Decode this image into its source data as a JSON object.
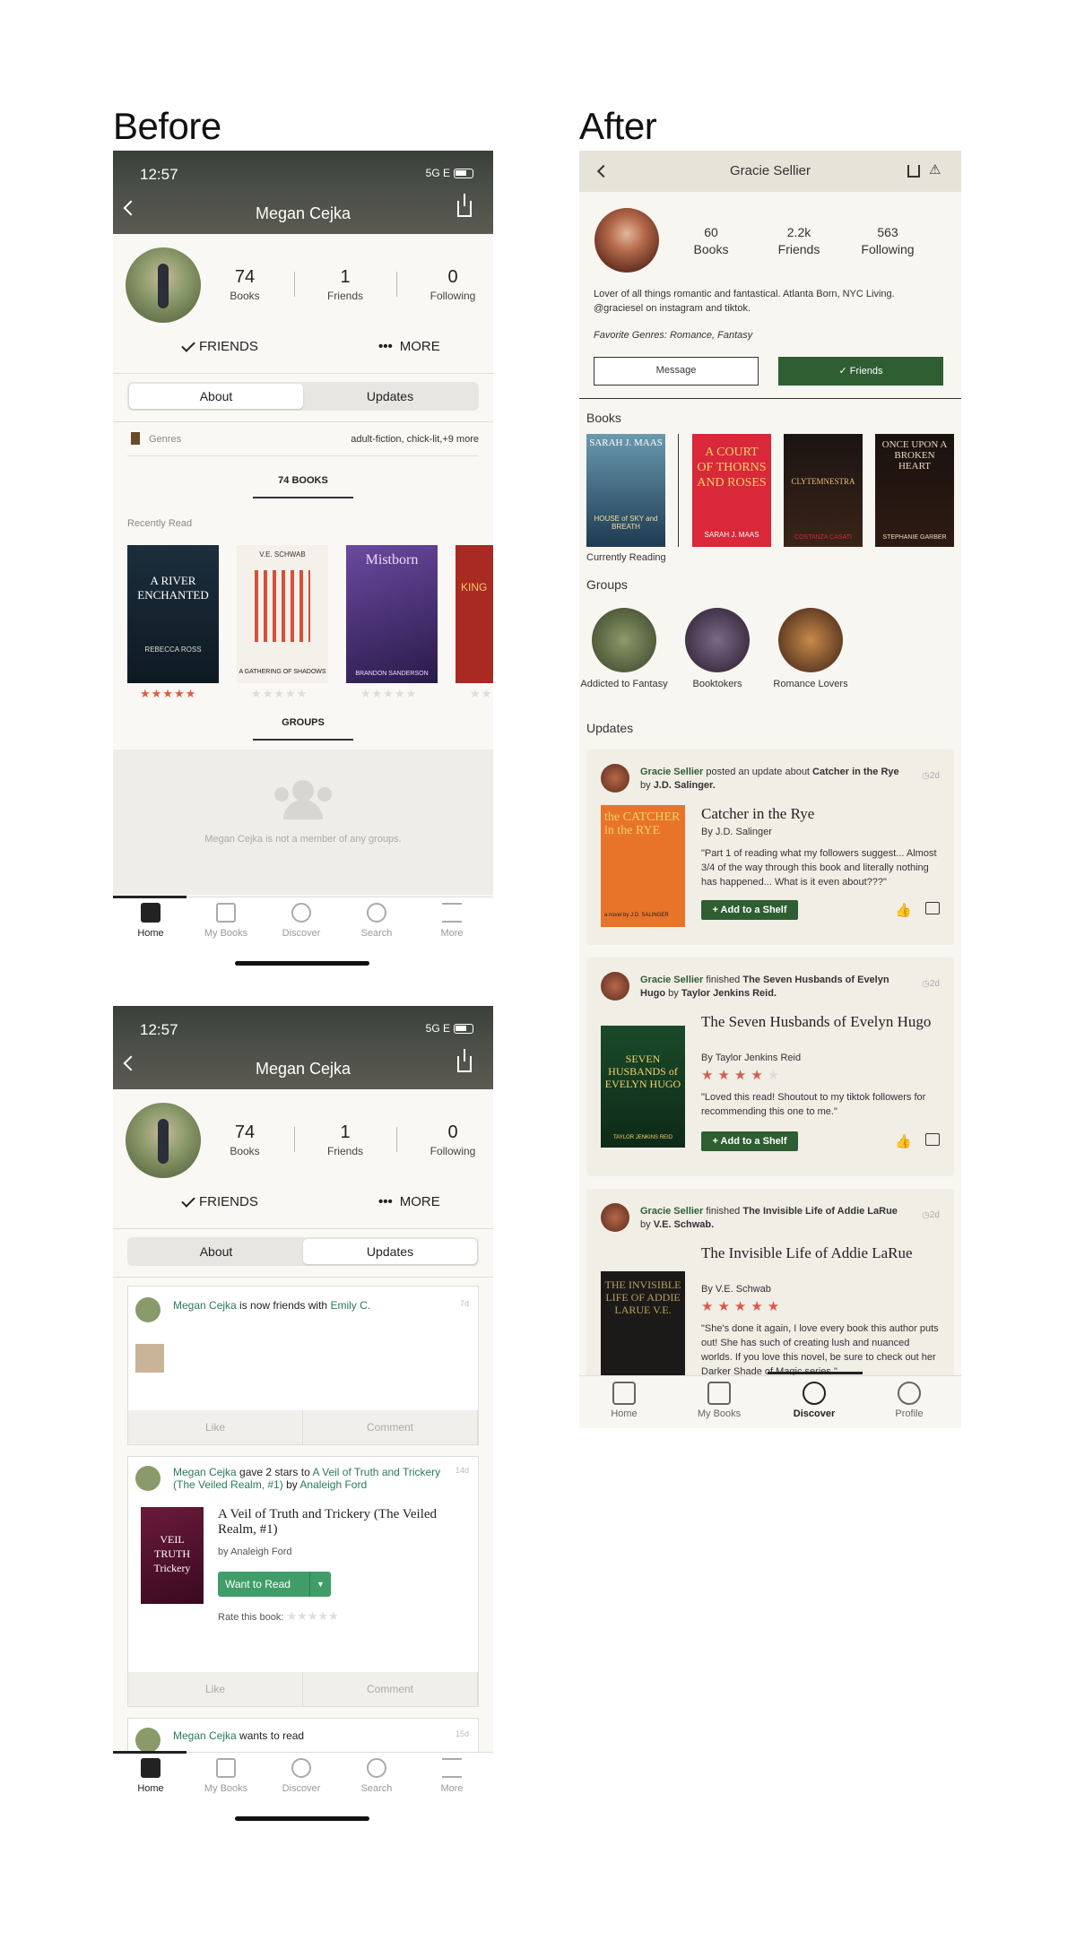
{
  "headings": {
    "before": "Before",
    "after": "After"
  },
  "before": {
    "status": {
      "time": "12:57",
      "network": "5G E"
    },
    "title": "Megan Cejka",
    "stats": [
      {
        "n": "74",
        "l": "Books"
      },
      {
        "n": "1",
        "l": "Friends"
      },
      {
        "n": "0",
        "l": "Following"
      }
    ],
    "actions": {
      "friends": "FRIENDS",
      "more": "MORE"
    },
    "tabs": {
      "about": "About",
      "updates": "Updates"
    },
    "genres": {
      "label": "Genres",
      "value": "adult-fiction, chick-lit,+9 more"
    },
    "books_count": "74 BOOKS",
    "recently_read": "Recently Read",
    "covers": [
      {
        "t": "A RIVER ENCHANTED",
        "a": "REBECCA ROSS"
      },
      {
        "t": "A GATHERING OF SHADOWS",
        "a": "V.E. SCHWAB"
      },
      {
        "t": "Mistborn",
        "a": "BRANDON SANDERSON"
      },
      {
        "t": "KING",
        "a": ""
      }
    ],
    "groups_label": "GROUPS",
    "no_groups": "Megan Cejka is not a member of any groups.",
    "tabbar": [
      "Home",
      "My Books",
      "Discover",
      "Search",
      "More"
    ],
    "feed": [
      {
        "user": "Megan Cejka",
        "text": " is now friends with ",
        "target": "Emily C.",
        "time": "7d"
      },
      {
        "user": "Megan Cejka",
        "text": " gave 2 stars to ",
        "target": "A Veil of Truth and Trickery (The Veiled Realm, #1)",
        "by": " by ",
        "author": "Analeigh Ford",
        "time": "14d",
        "book_title": "A Veil of Truth and Trickery (The Veiled Realm, #1)",
        "book_author": "by Analeigh Ford",
        "want": "Want to Read",
        "rate": "Rate this book:",
        "cover": "VEIL TRUTH Trickery"
      },
      {
        "user": "Megan Cejka",
        "text": " wants to read",
        "time": "15d"
      }
    ],
    "like": "Like",
    "comment": "Comment"
  },
  "after": {
    "title": "Gracie Sellier",
    "stats": [
      {
        "n": "60",
        "l": "Books"
      },
      {
        "n": "2.2k",
        "l": "Friends"
      },
      {
        "n": "563",
        "l": "Following"
      }
    ],
    "bio1": "Lover of all things romantic and fantastical. Atlanta Born, NYC Living.",
    "bio2": "@graciesel on instagram and tiktok.",
    "genres": "Favorite Genres: Romance, Fantasy",
    "message": "Message",
    "friends": "Friends",
    "books_label": "Books",
    "currently_reading": "Currently Reading",
    "covers": [
      {
        "t": "SARAH J. MAAS",
        "s": "HOUSE of SKY and BREATH"
      },
      {
        "t": "A COURT OF THORNS AND ROSES",
        "s": "SARAH J. MAAS"
      },
      {
        "t": "CLYTEMNESTRA",
        "s": "COSTANZA CASATI"
      },
      {
        "t": "ONCE UPON A BROKEN HEART",
        "s": "STEPHANIE GARBER"
      }
    ],
    "groups_label": "Groups",
    "groups": [
      "Addicted to Fantasy",
      "Booktokers",
      "Romance Lovers"
    ],
    "updates_label": "Updates",
    "updates": [
      {
        "user": "Gracie Sellier",
        "action": " posted an update about ",
        "book": "Catcher in the Rye",
        "by": " by ",
        "author": "J.D. Salinger.",
        "time": "2d",
        "title": "Catcher in the Rye",
        "author_line": "By J.D. Salinger",
        "quote": "\"Part 1 of reading what my followers suggest... Almost 3/4 of the way through this book and literally nothing has happened... What is it even about???\"",
        "btn": "+ Add to a Shelf",
        "cover": "the CATCHER in the RYE",
        "cover_by": "a novel by J.D. SALINGER"
      },
      {
        "user": "Gracie Sellier",
        "action": " finished ",
        "book": "The Seven Husbands of Evelyn Hugo",
        "by": " by ",
        "author": "Taylor Jenkins Reid.",
        "time": "2d",
        "title": "The Seven Husbands of Evelyn Hugo",
        "author_line": "By Taylor Jenkins Reid",
        "quote": "\"Loved this read! Shoutout to my tiktok followers for recommending this one to me.\"",
        "btn": "+ Add to a Shelf",
        "cover": "SEVEN HUSBANDS of EVELYN HUGO",
        "cover_by": "TAYLOR JENKINS REID",
        "stars": 4
      },
      {
        "user": "Gracie Sellier",
        "action": " finished ",
        "book": "The Invisible Life of Addie LaRue",
        "by": " by ",
        "author": "V.E. Schwab.",
        "time": "2d",
        "title": "The Invisible Life of Addie LaRue",
        "author_line": "By V.E. Schwab",
        "quote": "\"She's done it again, I love every book this author puts out! She has such of creating lush and nuanced worlds. If you love this novel, be sure to check out her Darker Shade of Magic series.\"",
        "cover": "THE INVISIBLE LIFE OF ADDIE LARUE V.E.",
        "stars": 5
      }
    ],
    "tabbar": [
      "Home",
      "My Books",
      "Discover",
      "Profile"
    ]
  }
}
